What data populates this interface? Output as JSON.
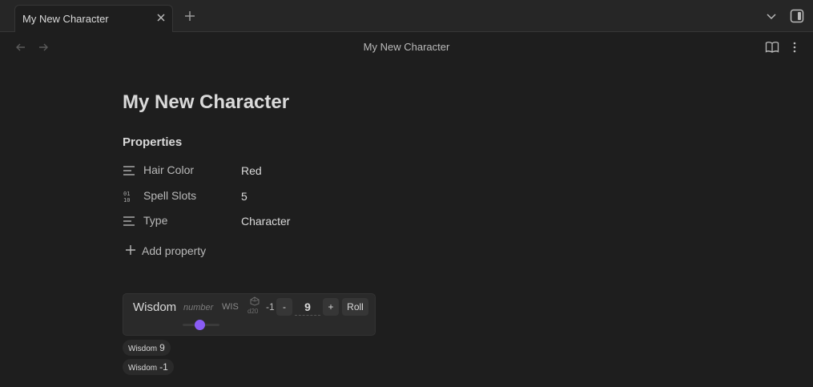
{
  "tab": {
    "title": "My New Character"
  },
  "header": {
    "title": "My New Character"
  },
  "page": {
    "title": "My New Character"
  },
  "properties": {
    "heading": "Properties",
    "items": [
      {
        "key": "Hair Color",
        "value": "Red",
        "icon": "text-lines-icon"
      },
      {
        "key": "Spell Slots",
        "value": "5",
        "icon": "number-icon"
      },
      {
        "key": "Type",
        "value": "Character",
        "icon": "text-lines-icon"
      }
    ],
    "add_label": "Add property"
  },
  "widget": {
    "label": "Wisdom",
    "type": "number",
    "abbr": "WIS",
    "dice": "d20",
    "modifier": "-1",
    "minus": "-",
    "value": "9",
    "plus": "+",
    "roll": "Roll",
    "slider_level": 0.45,
    "accent": "#8a5cf5"
  },
  "chips": [
    {
      "label": "Wisdom",
      "value": "9"
    },
    {
      "label": "Wisdom",
      "value": "-1"
    }
  ]
}
